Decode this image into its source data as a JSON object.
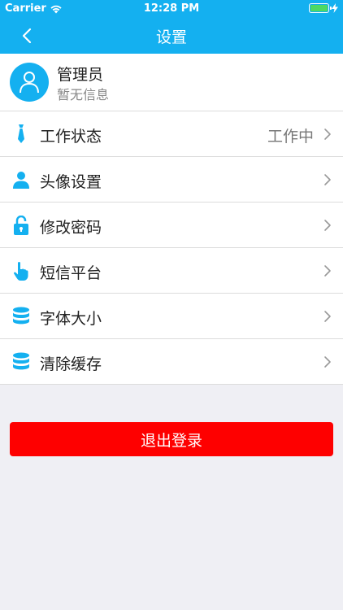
{
  "status_bar": {
    "carrier": "Carrier",
    "time": "12:28 PM"
  },
  "navbar": {
    "title": "设置"
  },
  "profile": {
    "name": "管理员",
    "subtitle": "暂无信息"
  },
  "menu": {
    "items": [
      {
        "label": "工作状态",
        "value": "工作中",
        "icon": "tie-icon"
      },
      {
        "label": "头像设置",
        "icon": "user-icon"
      },
      {
        "label": "修改密码",
        "icon": "lock-icon"
      },
      {
        "label": "短信平台",
        "icon": "hand-pointer-icon"
      },
      {
        "label": "字体大小",
        "icon": "database-icon"
      },
      {
        "label": "清除缓存",
        "icon": "database-icon"
      }
    ]
  },
  "logout": {
    "label": "退出登录"
  },
  "colors": {
    "primary": "#14b0f0",
    "danger": "#fe0000",
    "background": "#efeff4",
    "battery": "#4cd964"
  }
}
